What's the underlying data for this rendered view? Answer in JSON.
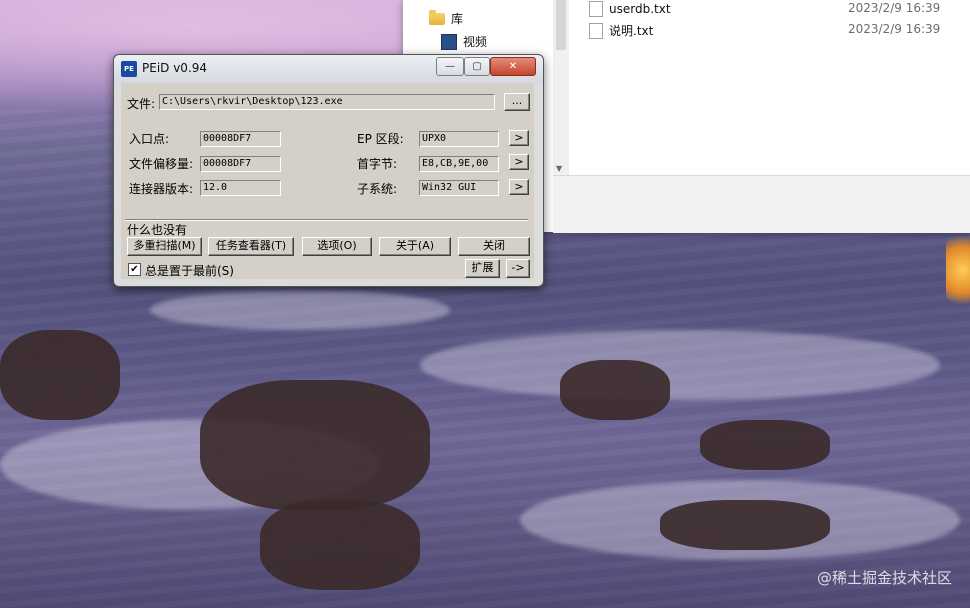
{
  "explorer": {
    "nav": [
      {
        "label": "库",
        "icon": "folder-icon"
      },
      {
        "label": "视频",
        "icon": "video-icon"
      }
    ],
    "files": [
      {
        "name": "userdb.txt",
        "date": "2023/2/9 16:39"
      },
      {
        "name": "说明.txt",
        "date": "2023/2/9 16:39"
      }
    ]
  },
  "peid": {
    "title": "PEiD v0.94",
    "file_label": "文件:",
    "file_path": "C:\\Users\\rkvir\\Desktop\\123.exe",
    "browse_label": "...",
    "entry_point_label": "入口点:",
    "entry_point": "00008DF7",
    "file_offset_label": "文件偏移量:",
    "file_offset": "00008DF7",
    "linker_label": "连接器版本:",
    "linker_version": "12.0",
    "ep_section_label": "EP 区段:",
    "ep_section": "UPX0",
    "first_bytes_label": "首字节:",
    "first_bytes": "E8,CB,9E,00",
    "subsystem_label": "子系统:",
    "subsystem": "Win32 GUI",
    "arrow_label": ">",
    "result": "什么也没有",
    "buttons": {
      "multi_scan": "多重扫描(M)",
      "task_viewer": "任务查看器(T)",
      "options": "选项(O)",
      "about": "关于(A)",
      "close": "关闭",
      "extend": "扩展",
      "plugin": "->"
    },
    "always_on_top_label": "总是置于最前(S)",
    "always_on_top_checked": "✔",
    "window_buttons": {
      "minimize": "—",
      "maximize": "▢",
      "close": "✕"
    }
  },
  "watermark": "@稀土掘金技术社区"
}
